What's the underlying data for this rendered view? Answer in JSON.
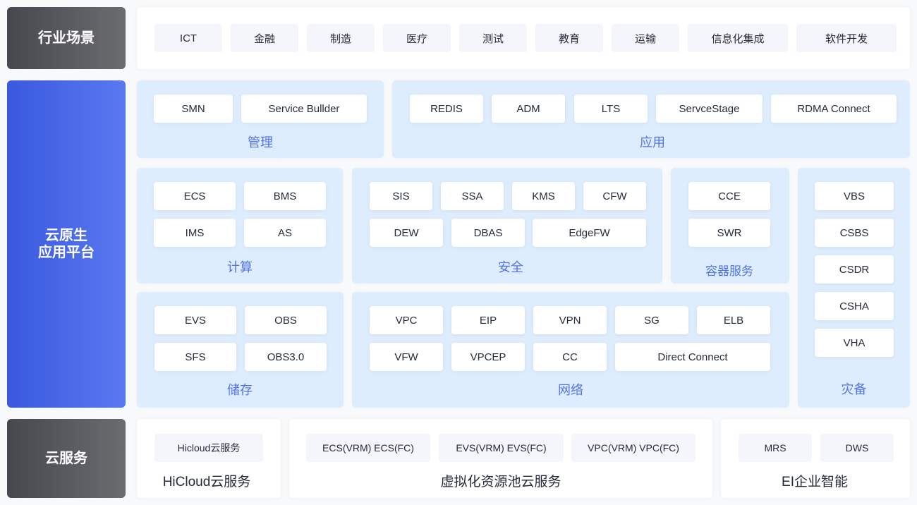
{
  "colors": {
    "accent_blue": "#5473ea",
    "panel_blue": "#deedfd",
    "chip_grey": "#f4f6fb",
    "label_dark": "#55565b",
    "label_blue": "#4665e8"
  },
  "industry": {
    "label": "行业场景",
    "items": [
      "ICT",
      "金融",
      "制造",
      "医疗",
      "测试",
      "教育",
      "运输",
      "信息化集成",
      "软件开发"
    ]
  },
  "platform": {
    "label": "云原生\n应用平台",
    "groups": {
      "management": {
        "title": "管理",
        "items": [
          "SMN",
          "Service Bullder"
        ]
      },
      "application": {
        "title": "应用",
        "items": [
          "REDIS",
          "ADM",
          "LTS",
          "ServceStage",
          "RDMA Connect"
        ]
      },
      "compute": {
        "title": "计算",
        "items": [
          "ECS",
          "BMS",
          "IMS",
          "AS"
        ]
      },
      "security": {
        "title": "安全",
        "items": [
          "SIS",
          "SSA",
          "KMS",
          "CFW",
          "DEW",
          "DBAS",
          "EdgeFW"
        ]
      },
      "container": {
        "title": "容器服务",
        "items": [
          "CCE",
          "SWR"
        ]
      },
      "disaster_recovery": {
        "title": "灾备",
        "items": [
          "VBS",
          "CSBS",
          "CSDR",
          "CSHA",
          "VHA"
        ]
      },
      "storage": {
        "title": "储存",
        "items": [
          "EVS",
          "OBS",
          "SFS",
          "OBS3.0"
        ]
      },
      "network": {
        "title": "网络",
        "items": [
          "VPC",
          "EIP",
          "VPN",
          "SG",
          "ELB",
          "VFW",
          "VPCEP",
          "CC",
          "Direct Connect"
        ]
      }
    }
  },
  "cloud": {
    "label": "云服务",
    "groups": {
      "hicloud": {
        "title": "HiCloud云服务",
        "items": [
          "Hicloud云服务"
        ]
      },
      "virtual_pool": {
        "title": "虚拟化资源池云服务",
        "items": [
          "ECS(VRM) ECS(FC)",
          "EVS(VRM) EVS(FC)",
          "VPC(VRM) VPC(FC)"
        ]
      },
      "ei": {
        "title": "EI企业智能",
        "items": [
          "MRS",
          "DWS"
        ]
      }
    }
  }
}
